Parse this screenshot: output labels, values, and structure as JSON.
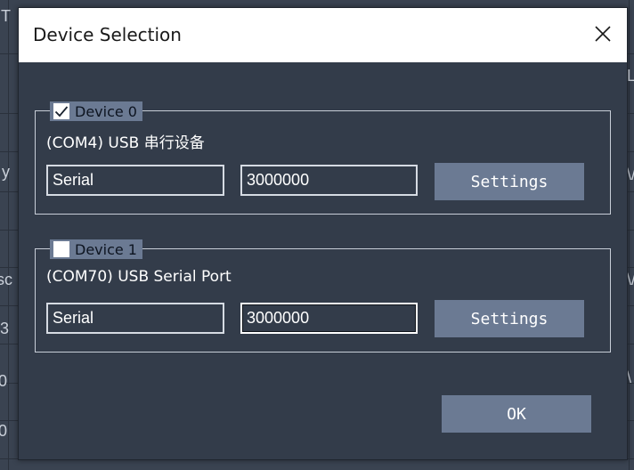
{
  "background": {
    "visible_chars": [
      "T",
      "y",
      "sc",
      "3",
      "0",
      "0",
      "\\/",
      "\\/",
      "L",
      "\\"
    ]
  },
  "dialog": {
    "title": "Device Selection",
    "close_icon": "close-icon",
    "devices": [
      {
        "label": "Device 0",
        "checked": true,
        "port_name": "(COM4) USB 串行设备",
        "type_value": "Serial",
        "baud_value": "3000000",
        "settings_label": "Settings"
      },
      {
        "label": "Device 1",
        "checked": false,
        "port_name": "(COM70) USB Serial Port",
        "type_value": "Serial",
        "baud_value": "3000000",
        "settings_label": "Settings"
      }
    ],
    "ok_label": "OK"
  },
  "colors": {
    "dialog_bg": "#333c4a",
    "accent": "#6b7a93",
    "titlebar": "#ffffff"
  }
}
